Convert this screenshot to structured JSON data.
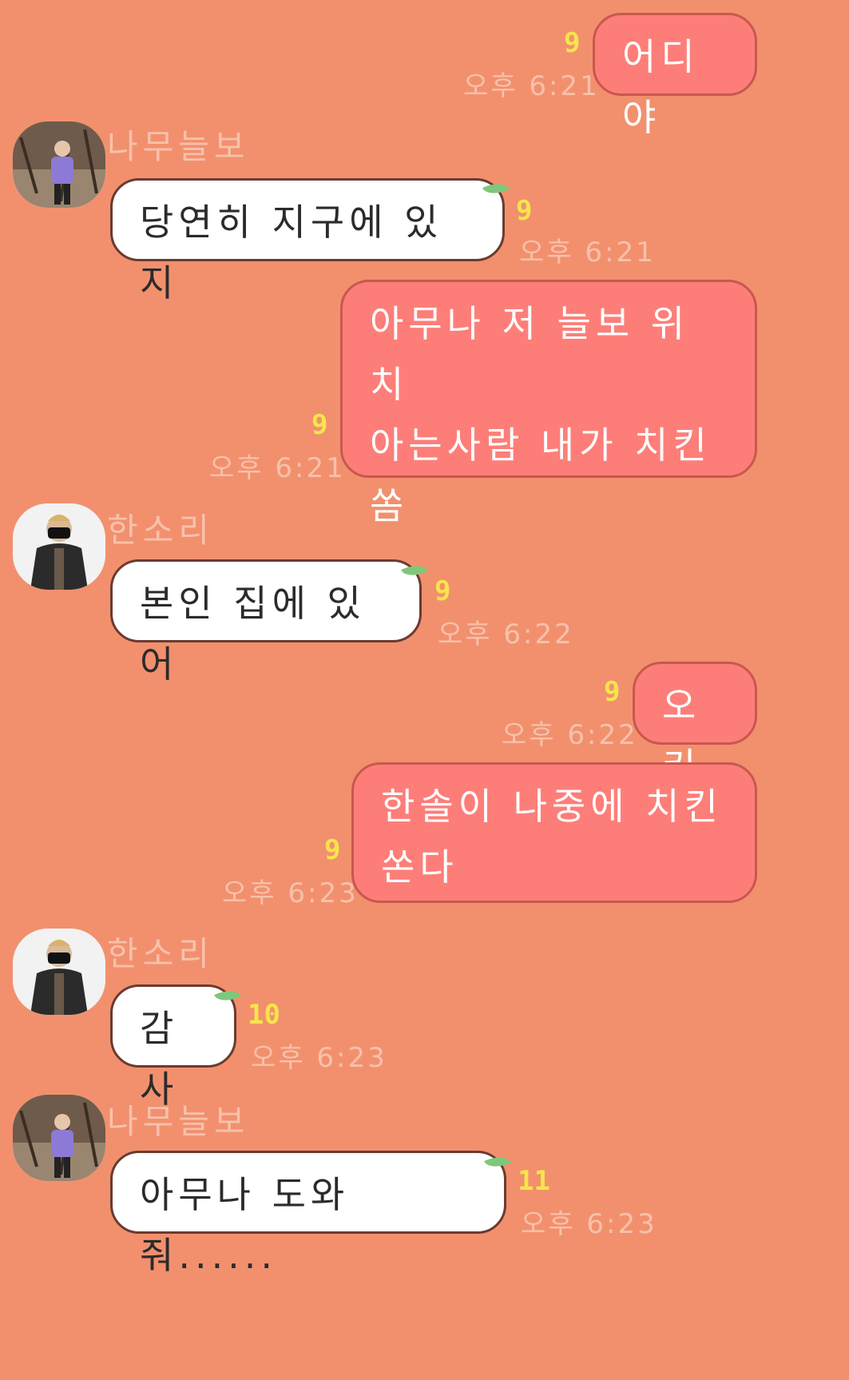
{
  "messages": [
    {
      "from": "me",
      "text": "어디야",
      "unread": "9",
      "time": "오후 6:21"
    },
    {
      "from": "them",
      "sender": "나무늘보",
      "text": "당연히 지구에 있지",
      "unread": "9",
      "time": "오후 6:21"
    },
    {
      "from": "me",
      "text": "아무나 저 늘보 위치\n아는사람 내가 치킨\n쏨",
      "unread": "9",
      "time": "오후 6:21"
    },
    {
      "from": "them",
      "sender": "한소리",
      "text": "본인 집에 있어",
      "unread": "9",
      "time": "오후 6:22"
    },
    {
      "from": "me",
      "text": "오키",
      "unread": "9",
      "time": "오후 6:22"
    },
    {
      "from": "me",
      "text": "한솔이 나중에 치킨\n쏜다",
      "unread": "9",
      "time": "오후 6:23"
    },
    {
      "from": "them",
      "sender": "한소리",
      "text": "감사",
      "unread": "10",
      "time": "오후 6:23"
    },
    {
      "from": "them",
      "sender": "나무늘보",
      "text": "아무나 도와줘......",
      "unread": "11",
      "time": "오후 6:23"
    }
  ],
  "colors": {
    "background": "#f2906e",
    "my_bubble": "#fd7e79",
    "their_bubble": "#ffffff",
    "unread": "#f6e54b",
    "time": "#f7c1ab"
  },
  "icons": {
    "leaf": "leaf-icon",
    "avatar_namu": "avatar-namu-icon",
    "avatar_hansori": "avatar-hansori-icon"
  }
}
